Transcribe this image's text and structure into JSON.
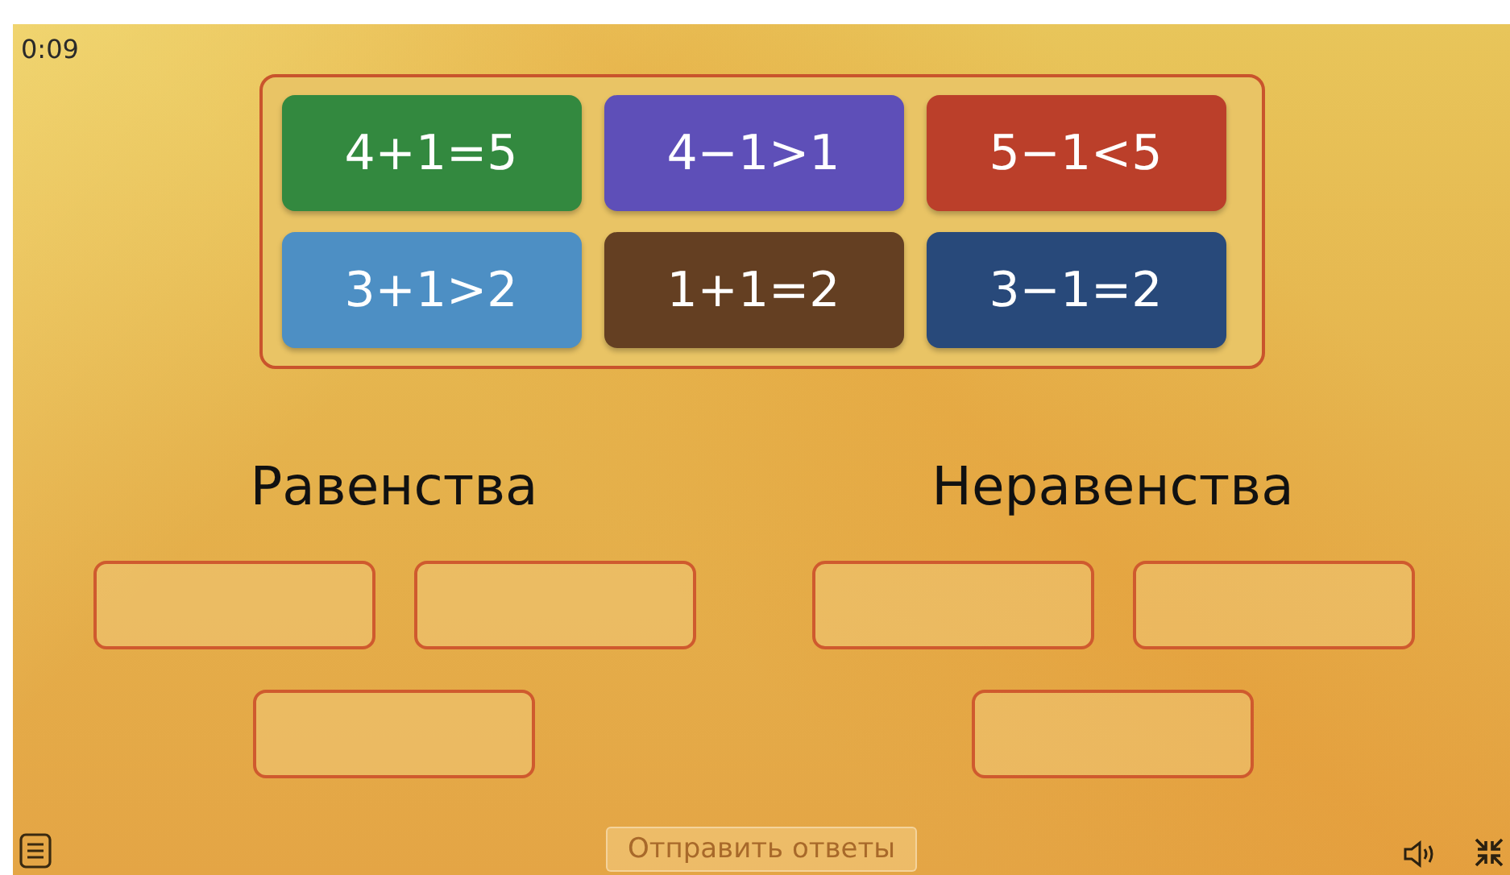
{
  "timer": "0:09",
  "cards": [
    {
      "label": "4+1=5",
      "color": "#33893f"
    },
    {
      "label": "4−1>1",
      "color": "#5e4fb8"
    },
    {
      "label": "5−1<5",
      "color": "#bb3f2a"
    },
    {
      "label": "3+1>2",
      "color": "#4d8fc4"
    },
    {
      "label": "1+1=2",
      "color": "#643f22"
    },
    {
      "label": "3−1=2",
      "color": "#28497a"
    }
  ],
  "groups": [
    {
      "title": "Равенства"
    },
    {
      "title": "Неравенства"
    }
  ],
  "submit_button": {
    "label": "Отправить ответы",
    "disabled": true
  }
}
